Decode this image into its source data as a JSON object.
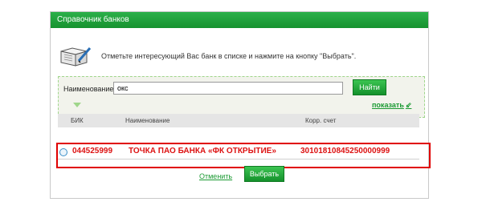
{
  "dialog": {
    "title": "Справочник банков",
    "instruction": "Отметьте интересующий Вас банк в списке и нажмите на кнопку \"Выбрать\"."
  },
  "search": {
    "label": "Наименование",
    "value": "окс",
    "find_button": "Найти",
    "show_link": "показать"
  },
  "table": {
    "columns": [
      "БИК",
      "Наименование",
      "Корр. счет"
    ],
    "rows": [
      {
        "bik": "044525999",
        "name": "ТОЧКА ПАО БАНКА «ФК ОТКРЫТИЕ»",
        "account": "30101810845250000999"
      }
    ]
  },
  "actions": {
    "cancel": "Отменить",
    "select": "Выбрать"
  },
  "colors": {
    "accent_green": "#16922f",
    "highlight_red": "#e00000"
  }
}
